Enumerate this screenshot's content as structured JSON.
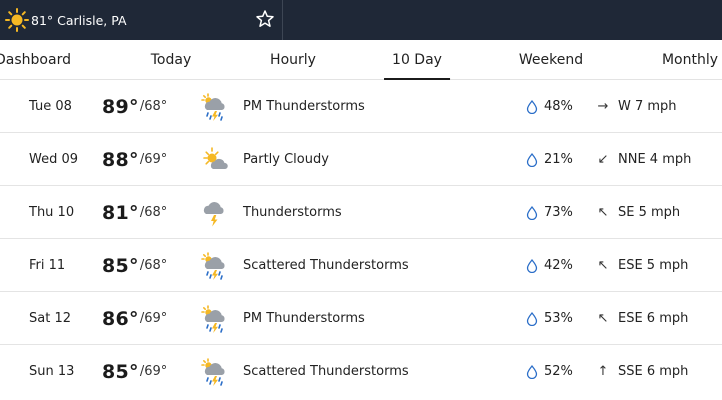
{
  "header": {
    "location_temp": "81°",
    "location_name": "Carlisle, PA",
    "location_label": "81° Carlisle, PA"
  },
  "tabs": [
    {
      "label": "Dashboard"
    },
    {
      "label": "Today"
    },
    {
      "label": "Hourly"
    },
    {
      "label": "10 Day",
      "active": true
    },
    {
      "label": "Weekend"
    },
    {
      "label": "Monthly"
    }
  ],
  "days": [
    {
      "day": "Tue 08",
      "high": "89°",
      "low": "/68°",
      "condition": "PM Thunderstorms",
      "icon": "rain-thunder-icon",
      "precip": "48%",
      "wind": "W 7 mph",
      "wind_dir": "→"
    },
    {
      "day": "Wed 09",
      "high": "88°",
      "low": "/69°",
      "condition": "Partly Cloudy",
      "icon": "partly-cloudy-icon",
      "precip": "21%",
      "wind": "NNE 4 mph",
      "wind_dir": "↙"
    },
    {
      "day": "Thu 10",
      "high": "81°",
      "low": "/68°",
      "condition": "Thunderstorms",
      "icon": "thunderstorm-icon",
      "precip": "73%",
      "wind": "SE 5 mph",
      "wind_dir": "↖"
    },
    {
      "day": "Fri 11",
      "high": "85°",
      "low": "/68°",
      "condition": "Scattered Thunderstorms",
      "icon": "rain-thunder-icon",
      "precip": "42%",
      "wind": "ESE 5 mph",
      "wind_dir": "↖"
    },
    {
      "day": "Sat 12",
      "high": "86°",
      "low": "/69°",
      "condition": "PM Thunderstorms",
      "icon": "rain-thunder-icon",
      "precip": "53%",
      "wind": "ESE 6 mph",
      "wind_dir": "↖"
    },
    {
      "day": "Sun 13",
      "high": "85°",
      "low": "/69°",
      "condition": "Scattered Thunderstorms",
      "icon": "rain-thunder-icon",
      "precip": "52%",
      "wind": "SSE 6 mph",
      "wind_dir": "↑"
    }
  ],
  "colors": {
    "header_bg": "#1f2837",
    "sun": "#f5b824",
    "drop": "#2b6ec8"
  }
}
